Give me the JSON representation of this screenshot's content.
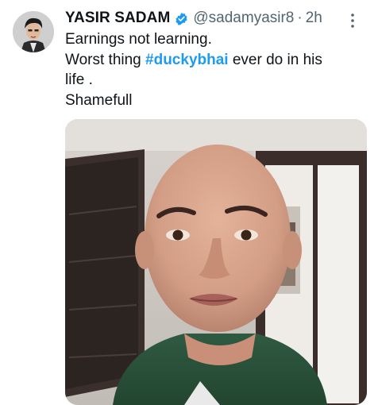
{
  "tweet": {
    "author_name": "YASIR SADAM",
    "handle": "@sadamyasir8",
    "separator": "·",
    "time": "2h",
    "verified_icon": "verified-badge-icon",
    "more_icon": "more-options-icon",
    "text": {
      "line1": "Earnings not learning.",
      "line2_before": "Worst thing ",
      "hashtag": "#duckybhai",
      "line2_after": " ever do in his",
      "line3": "life .",
      "line4": "Shamefull"
    },
    "colors": {
      "hashtag": "#1d9bf0",
      "verified": "#1d9bf0",
      "secondary_text": "#536471"
    }
  }
}
